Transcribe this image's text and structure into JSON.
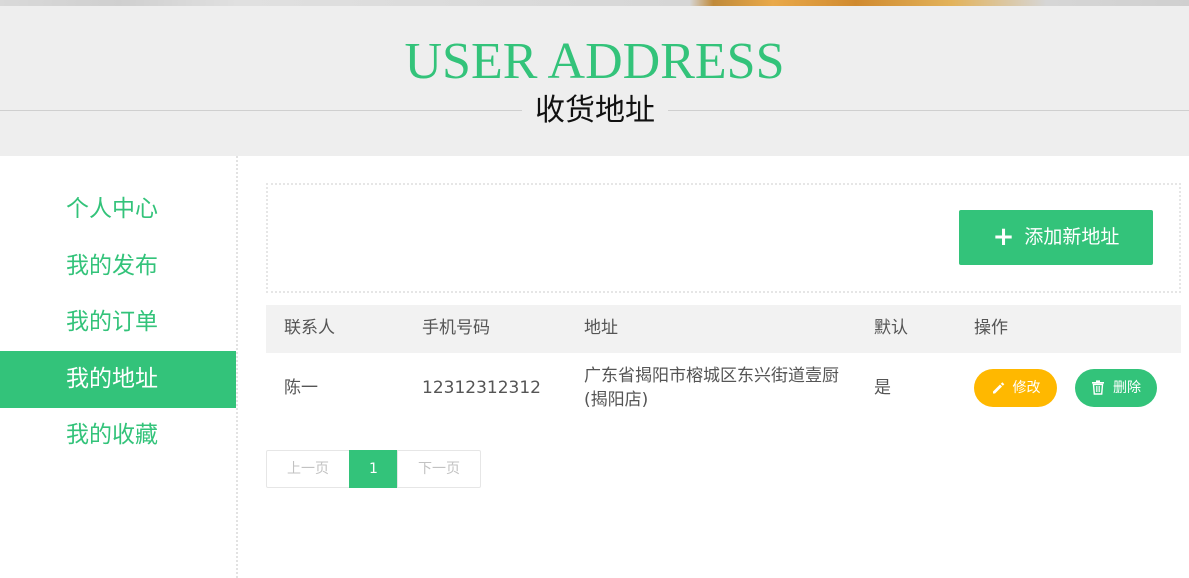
{
  "colors": {
    "accent": "#33c37a",
    "edit": "#ffb800",
    "header_bg": "#eeeeee"
  },
  "header": {
    "title": "USER ADDRESS",
    "subtitle": "收货地址"
  },
  "sidebar": {
    "items": [
      {
        "label": "个人中心"
      },
      {
        "label": "我的发布"
      },
      {
        "label": "我的订单"
      },
      {
        "label": "我的地址"
      },
      {
        "label": "我的收藏"
      }
    ],
    "active": "我的地址"
  },
  "toolbar": {
    "add_label": "添加新地址",
    "add_icon": "plus-icon"
  },
  "table": {
    "headers": [
      "联系人",
      "手机号码",
      "地址",
      "默认",
      "操作"
    ],
    "rows": [
      {
        "contact": "陈一",
        "phone": "12312312312",
        "address": "广东省揭阳市榕城区东兴街道壹厨(揭阳店)",
        "default": "是",
        "edit_label": "修改",
        "delete_label": "删除"
      }
    ]
  },
  "pagination": {
    "prev": "上一页",
    "current": "1",
    "next": "下一页"
  }
}
